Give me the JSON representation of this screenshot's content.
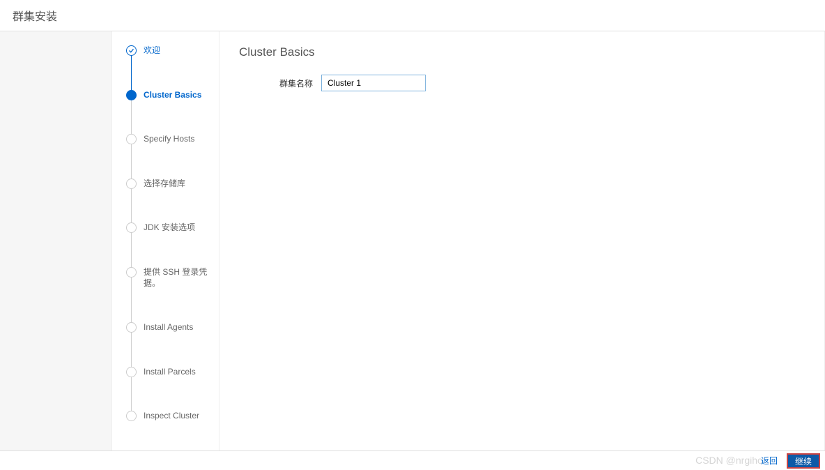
{
  "header": {
    "title": "群集安装"
  },
  "sidebar": {
    "steps": [
      {
        "label": "欢迎",
        "state": "completed"
      },
      {
        "label": "Cluster Basics",
        "state": "current"
      },
      {
        "label": "Specify Hosts",
        "state": "pending"
      },
      {
        "label": "选择存储库",
        "state": "pending"
      },
      {
        "label": "JDK 安装选项",
        "state": "pending"
      },
      {
        "label": "提供 SSH 登录凭据。",
        "state": "pending"
      },
      {
        "label": "Install Agents",
        "state": "pending"
      },
      {
        "label": "Install Parcels",
        "state": "pending"
      },
      {
        "label": "Inspect Cluster",
        "state": "pending"
      }
    ]
  },
  "main": {
    "title": "Cluster Basics",
    "form": {
      "cluster_name_label": "群集名称",
      "cluster_name_value": "Cluster 1"
    }
  },
  "footer": {
    "back_label": "返回",
    "continue_label": "继续"
  },
  "watermark": "CSDN @nrgihc"
}
